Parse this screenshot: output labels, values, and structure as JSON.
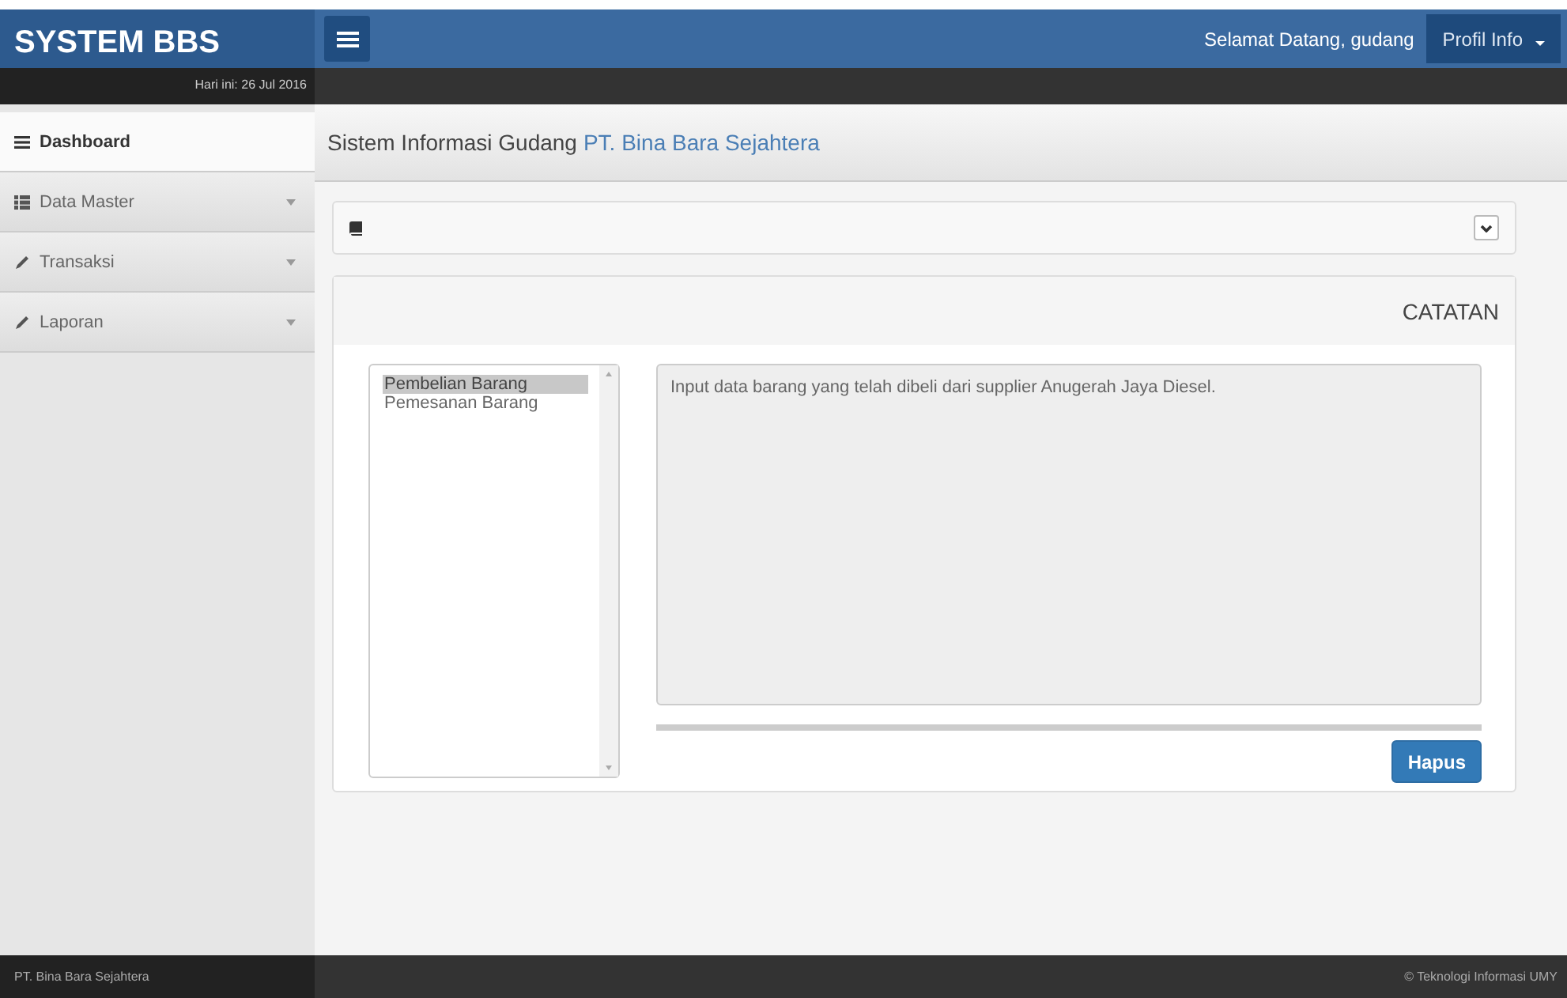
{
  "brand": "SYSTEM BBS",
  "date": "Hari ini: 26 Jul 2016",
  "welcome": "Selamat Datang, gudang",
  "profile_menu": "Profil Info",
  "sidebar": {
    "items": [
      {
        "label": "Dashboard",
        "kind": "lines",
        "selected": true,
        "submenu": false
      },
      {
        "label": "Data Master",
        "kind": "th-list",
        "selected": false,
        "submenu": true
      },
      {
        "label": "Transaksi",
        "kind": "pencil",
        "selected": false,
        "submenu": true
      },
      {
        "label": "Laporan",
        "kind": "pencil",
        "selected": false,
        "submenu": true
      }
    ]
  },
  "page_title": {
    "text": "Sistem Informasi Gudang",
    "company": "PT. Bina Bara Sejahtera"
  },
  "notes": {
    "title": "CATATAN",
    "list": [
      {
        "label": "Pembelian Barang",
        "selected": true
      },
      {
        "label": "Pemesanan Barang",
        "selected": false
      }
    ],
    "text": "Input data barang yang telah dibeli dari supplier Anugerah Jaya Diesel.",
    "button": "Hapus"
  },
  "footer": {
    "left": "PT. Bina Bara Sejahtera",
    "right": "© Teknologi Informasi UMY"
  }
}
